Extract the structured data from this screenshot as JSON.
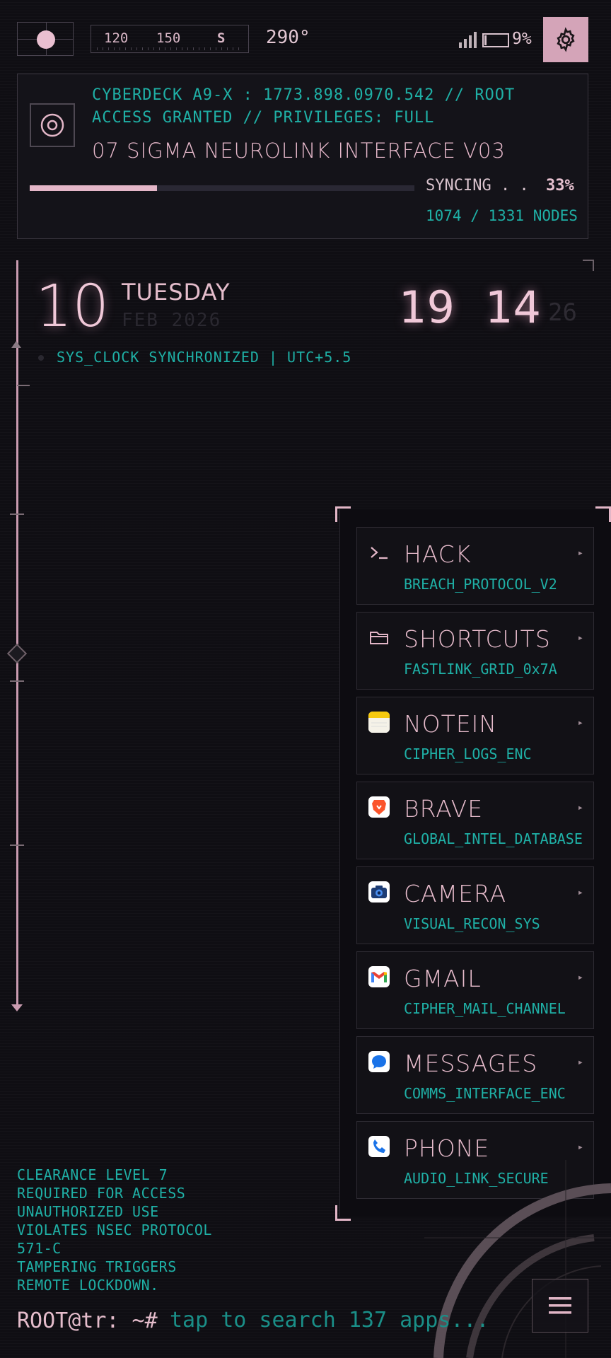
{
  "status_bar": {
    "ruler_labels": [
      "120",
      "150",
      "S"
    ],
    "heading": "290°",
    "battery_pct": "9%",
    "battery_level": 0.09,
    "settings_icon": "gear-icon",
    "signal_icon": "signal-icon"
  },
  "header": {
    "line1": "CYBERDECK A9-X : 1773.898.0970.542 // ROOT",
    "line2": "ACCESS GRANTED // PRIVILEGES: FULL",
    "title": "07 SIGMA NEUROLINK INTERFACE V03",
    "sync_label": "SYNCING . .",
    "sync_pct": "33%",
    "sync_fraction": 0.33,
    "nodes": "1074 / 1331 NODES"
  },
  "datetime": {
    "day": "10",
    "weekday": "TUESDAY",
    "month_year": "FEB 2026",
    "hour": "19",
    "minute": "14",
    "second": "26",
    "status": "SYS_CLOCK SYNCHRONIZED | UTC+5.5"
  },
  "apps": [
    {
      "name": "HACK",
      "sub": "BREACH_PROTOCOL_V2",
      "icon": "terminal-icon",
      "id": "hack"
    },
    {
      "name": "SHORTCUTS",
      "sub": "FASTLINK_GRID_0x7A",
      "icon": "folder-icon",
      "id": "shortcuts"
    },
    {
      "name": "NOTEIN",
      "sub": "CIPHER_LOGS_ENC",
      "icon": "notes-icon",
      "id": "notein"
    },
    {
      "name": "BRAVE",
      "sub": "GLOBAL_INTEL_DATABASE",
      "icon": "brave-icon",
      "id": "brave"
    },
    {
      "name": "CAMERA",
      "sub": "VISUAL_RECON_SYS",
      "icon": "camera-icon",
      "id": "camera"
    },
    {
      "name": "GMAIL",
      "sub": "CIPHER_MAIL_CHANNEL",
      "icon": "gmail-icon",
      "id": "gmail"
    },
    {
      "name": "MESSAGES",
      "sub": "COMMS_INTERFACE_ENC",
      "icon": "messages-icon",
      "id": "messages"
    },
    {
      "name": "PHONE",
      "sub": "AUDIO_LINK_SECURE",
      "icon": "phone-icon",
      "id": "phone"
    }
  ],
  "warning": [
    "CLEARANCE LEVEL 7",
    "REQUIRED FOR ACCESS",
    "UNAUTHORIZED USE",
    "VIOLATES NSEC PROTOCOL",
    "571-C",
    "TAMPERING TRIGGERS",
    "REMOTE LOCKDOWN."
  ],
  "terminal": {
    "prompt": "ROOT@tr: ~#",
    "placeholder": "tap to search 137 apps...",
    "menu_icon": "hamburger-icon"
  },
  "colors": {
    "accent_pink": "#e4b6c8",
    "accent_teal": "#1fb0a6",
    "background": "#0f0e13"
  }
}
